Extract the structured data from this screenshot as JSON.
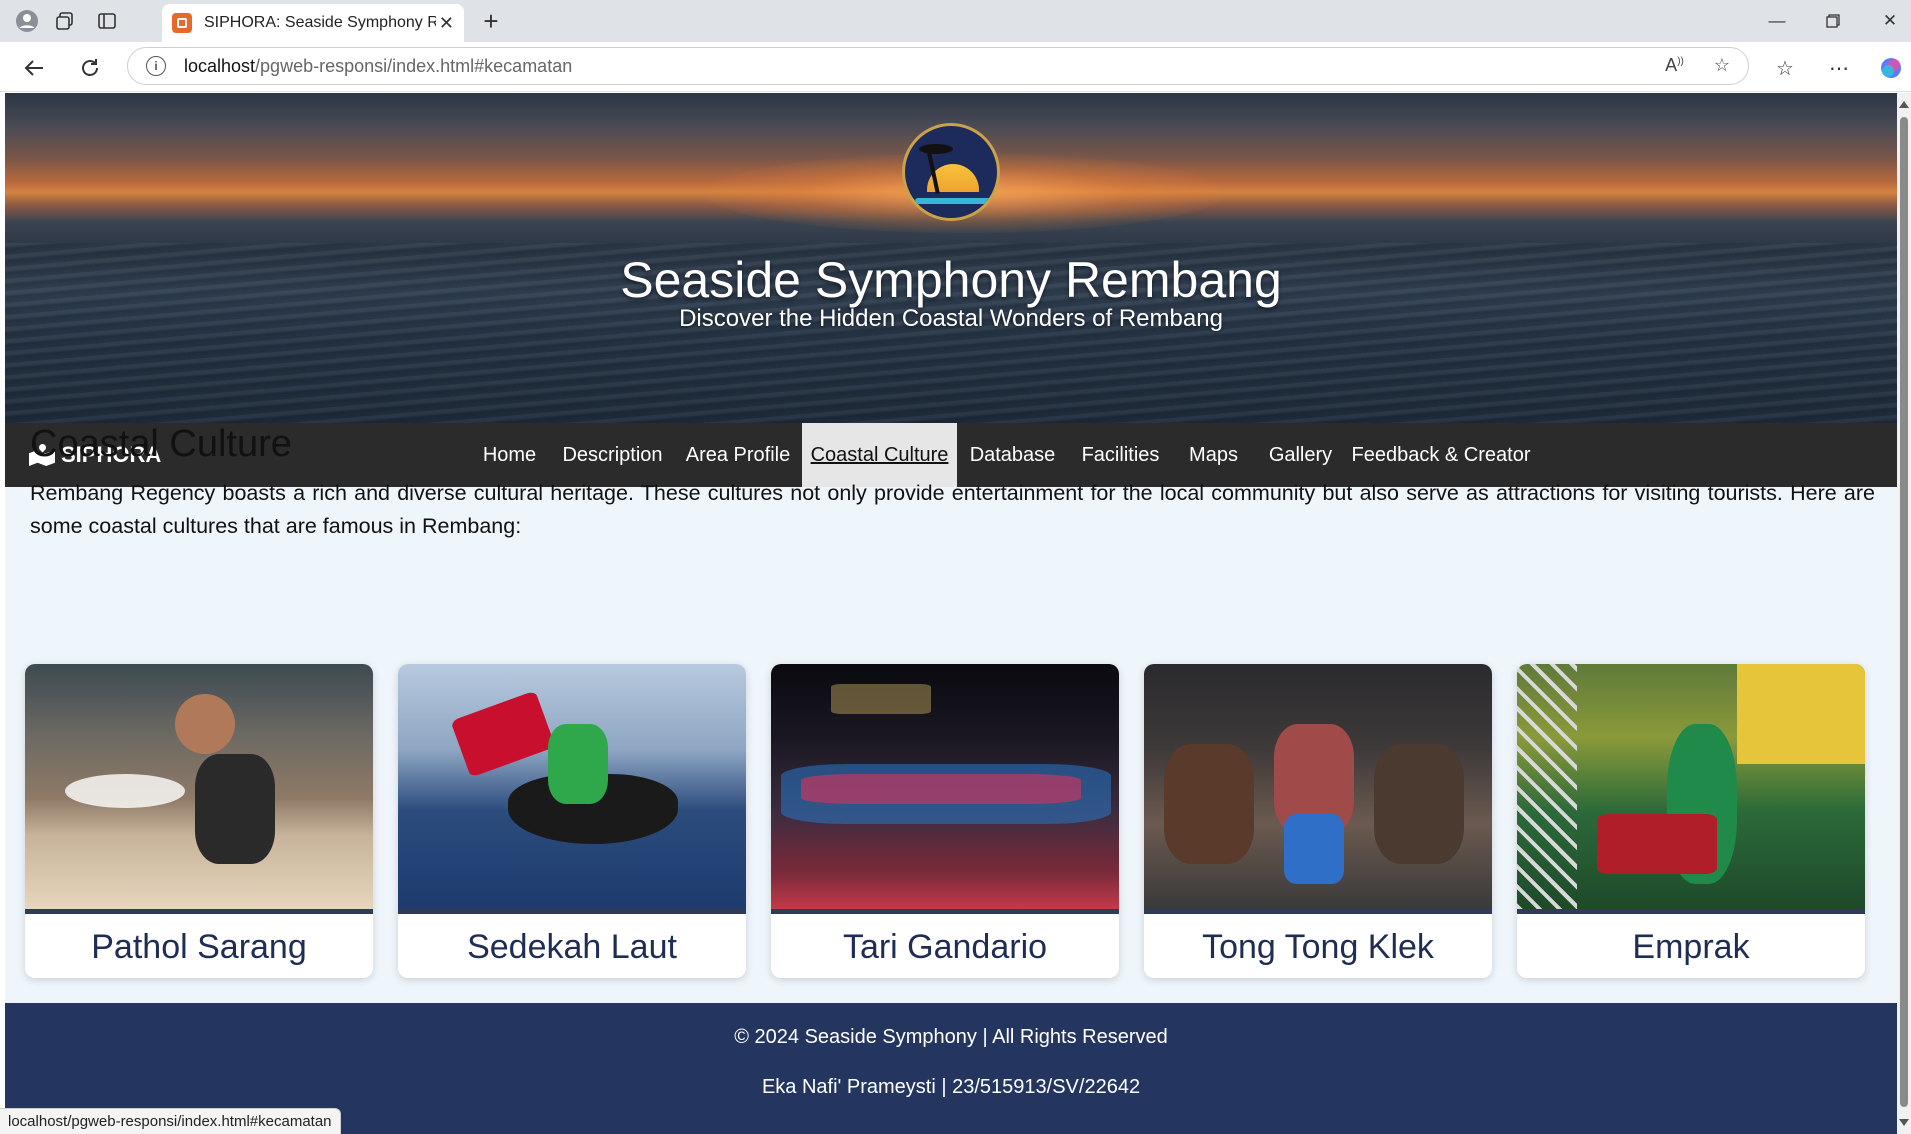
{
  "browser": {
    "tab_title": "SIPHORA: Seaside Symphony Rembang",
    "url_host": "localhost",
    "url_path": "/pgweb-responsi/index.html#kecamatan",
    "status_url": "localhost/pgweb-responsi/index.html#kecamatan"
  },
  "hero": {
    "title": "Seaside Symphony Rembang",
    "subtitle": "Discover the Hidden Coastal Wonders of Rembang"
  },
  "navbar": {
    "brand": "SIPHORA",
    "items": [
      {
        "label": "Home"
      },
      {
        "label": "Description"
      },
      {
        "label": "Area Profile"
      },
      {
        "label": "Coastal Culture",
        "active": true
      },
      {
        "label": "Database"
      },
      {
        "label": "Facilities"
      },
      {
        "label": "Maps"
      },
      {
        "label": "Gallery"
      },
      {
        "label": "Feedback & Creator"
      }
    ]
  },
  "section": {
    "title": "Coastal Culture",
    "description": "Rembang Regency boasts a rich and diverse cultural heritage. These cultures not only provide entertainment for the local community but also serve as attractions for visiting tourists. Here are some coastal cultures that are famous in Rembang:"
  },
  "cards": [
    {
      "label": "Pathol Sarang"
    },
    {
      "label": "Sedekah Laut"
    },
    {
      "label": "Tari Gandario"
    },
    {
      "label": "Tong Tong Klek"
    },
    {
      "label": "Emprak"
    }
  ],
  "footer": {
    "copyright": "© 2024 Seaside Symphony | All Rights Reserved",
    "author": "Eka Nafi' Prameysti | 23/515913/SV/22642"
  },
  "colors": {
    "navbar_bg": "#2b2b2b",
    "footer_bg": "#243660",
    "card_label": "#1f2d55",
    "page_bg": "#eef5fb"
  }
}
